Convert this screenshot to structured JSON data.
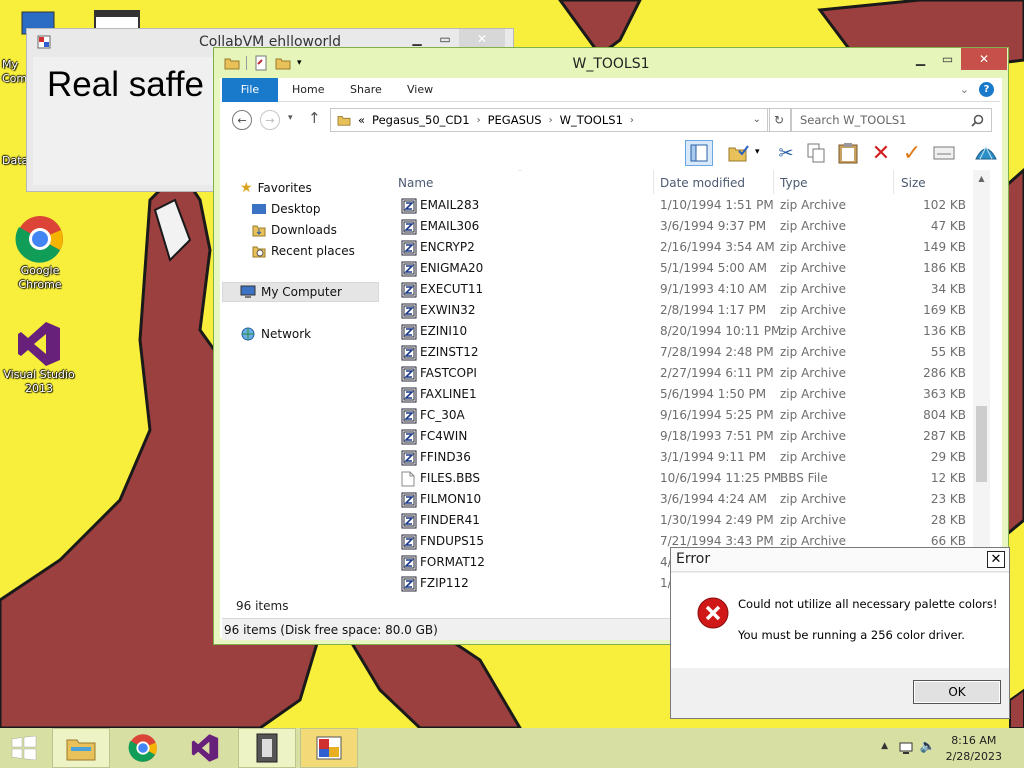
{
  "desktop": {
    "icons": [
      {
        "label": "My Computer"
      },
      {
        "label": "Data"
      },
      {
        "label": "Google Chrome"
      },
      {
        "label": "Visual Studio 2013"
      }
    ]
  },
  "collab_window": {
    "title": "CollabVM ehlloworld",
    "body_text": "Real saffe"
  },
  "explorer": {
    "title": "W_TOOLS1",
    "tabs": {
      "file": "File",
      "home": "Home",
      "share": "Share",
      "view": "View"
    },
    "breadcrumb": {
      "prefix": "«",
      "parts": [
        "Pegasus_50_CD1",
        "PEGASUS",
        "W_TOOLS1"
      ]
    },
    "search_placeholder": "Search W_TOOLS1",
    "nav": {
      "favorites": "Favorites",
      "desktop": "Desktop",
      "downloads": "Downloads",
      "recent": "Recent places",
      "mycomputer": "My Computer",
      "network": "Network"
    },
    "columns": {
      "name": "Name",
      "date": "Date modified",
      "type": "Type",
      "size": "Size"
    },
    "files": [
      {
        "name": "EMAIL283",
        "date": "1/10/1994 1:51 PM",
        "type": "zip Archive",
        "size": "102 KB",
        "icon": "zip"
      },
      {
        "name": "EMAIL306",
        "date": "3/6/1994 9:37 PM",
        "type": "zip Archive",
        "size": "47 KB",
        "icon": "zip"
      },
      {
        "name": "ENCRYP2",
        "date": "2/16/1994 3:54 AM",
        "type": "zip Archive",
        "size": "149 KB",
        "icon": "zip"
      },
      {
        "name": "ENIGMA20",
        "date": "5/1/1994 5:00 AM",
        "type": "zip Archive",
        "size": "186 KB",
        "icon": "zip"
      },
      {
        "name": "EXECUT11",
        "date": "9/1/1993 4:10 AM",
        "type": "zip Archive",
        "size": "34 KB",
        "icon": "zip"
      },
      {
        "name": "EXWIN32",
        "date": "2/8/1994 1:17 PM",
        "type": "zip Archive",
        "size": "169 KB",
        "icon": "zip"
      },
      {
        "name": "EZINI10",
        "date": "8/20/1994 10:11 PM",
        "type": "zip Archive",
        "size": "136 KB",
        "icon": "zip"
      },
      {
        "name": "EZINST12",
        "date": "7/28/1994 2:48 PM",
        "type": "zip Archive",
        "size": "55 KB",
        "icon": "zip"
      },
      {
        "name": "FASTCOPI",
        "date": "2/27/1994 6:11 PM",
        "type": "zip Archive",
        "size": "286 KB",
        "icon": "zip"
      },
      {
        "name": "FAXLINE1",
        "date": "5/6/1994 1:50 PM",
        "type": "zip Archive",
        "size": "363 KB",
        "icon": "zip"
      },
      {
        "name": "FC_30A",
        "date": "9/16/1994 5:25 PM",
        "type": "zip Archive",
        "size": "804 KB",
        "icon": "zip"
      },
      {
        "name": "FC4WIN",
        "date": "9/18/1993 7:51 PM",
        "type": "zip Archive",
        "size": "287 KB",
        "icon": "zip"
      },
      {
        "name": "FFIND36",
        "date": "3/1/1994 9:11 PM",
        "type": "zip Archive",
        "size": "29 KB",
        "icon": "zip"
      },
      {
        "name": "FILES.BBS",
        "date": "10/6/1994 11:25 PM",
        "type": "BBS File",
        "size": "12 KB",
        "icon": "doc"
      },
      {
        "name": "FILMON10",
        "date": "3/6/1994 4:24 AM",
        "type": "zip Archive",
        "size": "23 KB",
        "icon": "zip"
      },
      {
        "name": "FINDER41",
        "date": "1/30/1994 2:49 PM",
        "type": "zip Archive",
        "size": "28 KB",
        "icon": "zip"
      },
      {
        "name": "FNDUPS15",
        "date": "7/21/1994 3:43 PM",
        "type": "zip Archive",
        "size": "66 KB",
        "icon": "zip"
      },
      {
        "name": "FORMAT12",
        "date": "4/",
        "type": "",
        "size": "",
        "icon": "zip"
      },
      {
        "name": "FZIP112",
        "date": "1/",
        "type": "",
        "size": "",
        "icon": "zip"
      }
    ],
    "items_count": "96 items",
    "status": "96 items (Disk free space: 80.0 GB)"
  },
  "error_dialog": {
    "title": "Error",
    "message_line1": "Could not utilize all necessary palette colors!",
    "message_line2": "You must be running a 256 color driver.",
    "ok_label": "OK"
  },
  "taskbar": {
    "time": "8:16 AM",
    "date": "2/28/2023"
  },
  "colors": {
    "desktop_bg": "#f7ef3b",
    "window_frame": "#e6f5b9",
    "file_tab": "#1979ca",
    "close_button": "#c7504b",
    "taskbar": "#d8dfa3"
  }
}
